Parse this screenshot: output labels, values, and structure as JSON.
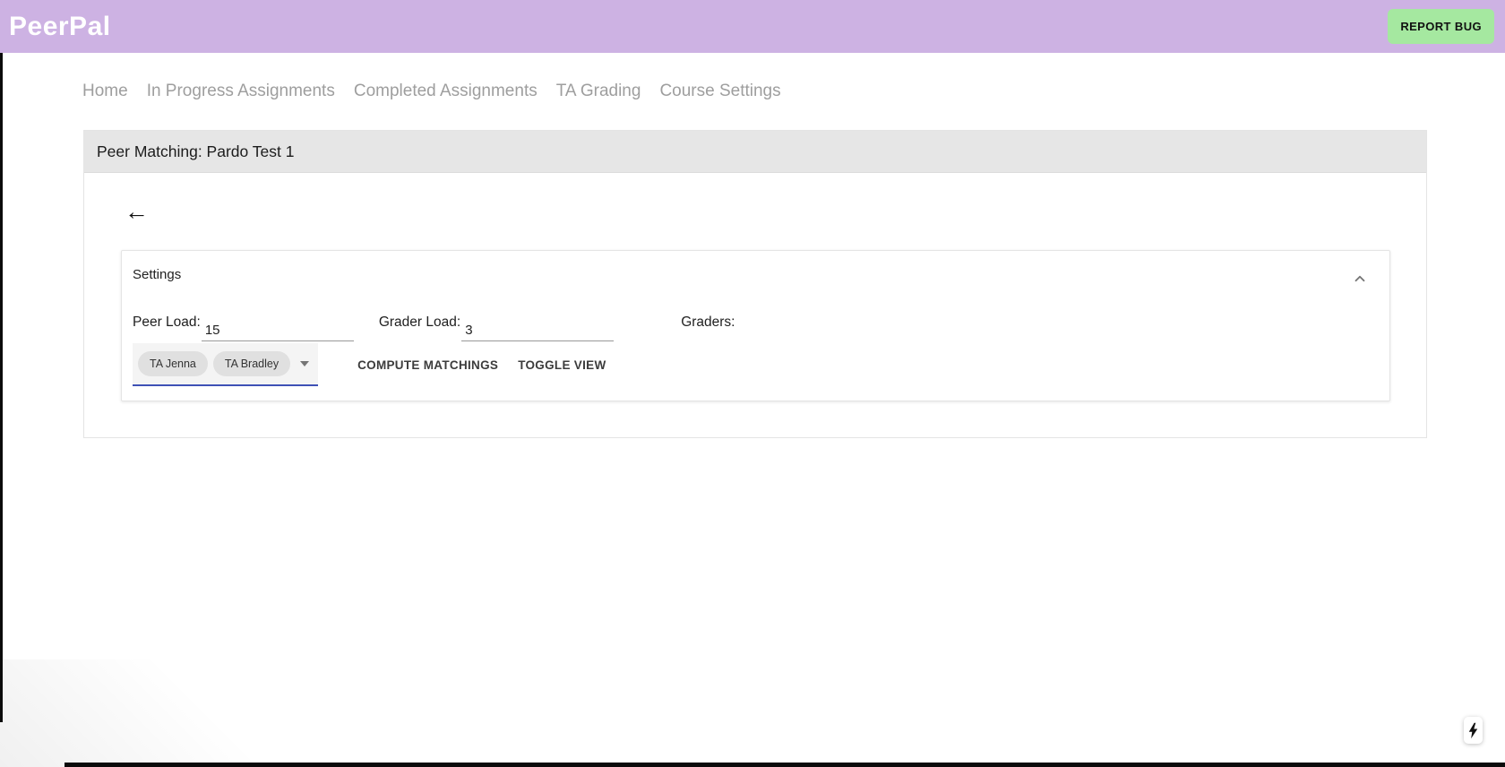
{
  "header": {
    "brand": "PeerPal",
    "report_bug_label": "REPORT BUG"
  },
  "nav": {
    "items": [
      {
        "label": "Home"
      },
      {
        "label": "In Progress Assignments"
      },
      {
        "label": "Completed Assignments"
      },
      {
        "label": "TA Grading"
      },
      {
        "label": "Course Settings"
      }
    ]
  },
  "card": {
    "title": "Peer Matching: Pardo Test 1"
  },
  "settings": {
    "title": "Settings",
    "peer_load_label": "Peer Load:",
    "peer_load_value": "15",
    "grader_load_label": "Grader Load:",
    "grader_load_value": "3",
    "graders_label": "Graders:",
    "grader_chips": [
      {
        "label": "TA Jenna"
      },
      {
        "label": "TA Bradley"
      }
    ],
    "compute_button_label": "COMPUTE MATCHINGS",
    "toggle_button_label": "TOGGLE VIEW"
  },
  "icons": {
    "back_arrow": "←"
  },
  "colors": {
    "header_bg": "#cdb2e3",
    "report_bug_bg": "#a5e8a0",
    "card_header_bg": "#e6e6e6",
    "graders_underline": "#3f51b5",
    "nav_text": "#9e9e9e"
  }
}
